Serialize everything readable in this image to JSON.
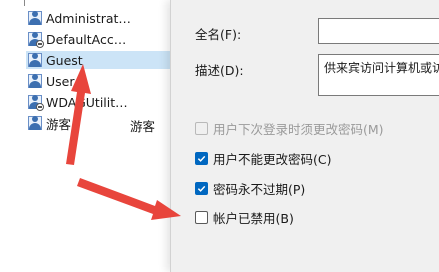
{
  "users_list": {
    "rows": [
      {
        "name": "Administrat…",
        "description": ""
      },
      {
        "name": "DefaultAcc…",
        "description": ""
      },
      {
        "name": "Guest",
        "description": "",
        "selected": true
      },
      {
        "name": "User",
        "description": ""
      },
      {
        "name": "WDAGUtilit…",
        "description": ""
      },
      {
        "name": "游客",
        "description": "游客"
      }
    ]
  },
  "properties": {
    "fullname_label": "全名(F):",
    "fullname_value": "",
    "description_label": "描述(D):",
    "description_value": "供来宾访问计算机或访",
    "options": [
      {
        "label": "用户下次登录时须更改密码(M)",
        "state": "disabled"
      },
      {
        "label": "用户不能更改密码(C)",
        "state": "checked"
      },
      {
        "label": "密码永不过期(P)",
        "state": "checked"
      },
      {
        "label": "帐户已禁用(B)",
        "state": "unchecked"
      }
    ]
  },
  "colors": {
    "annotation_arrow": "#e8453c",
    "checkbox_accent": "#0067c0",
    "selection": "#cce4f7"
  },
  "icons": [
    "user-icon",
    "checkmark-icon",
    "annotation-arrow-icon"
  ]
}
